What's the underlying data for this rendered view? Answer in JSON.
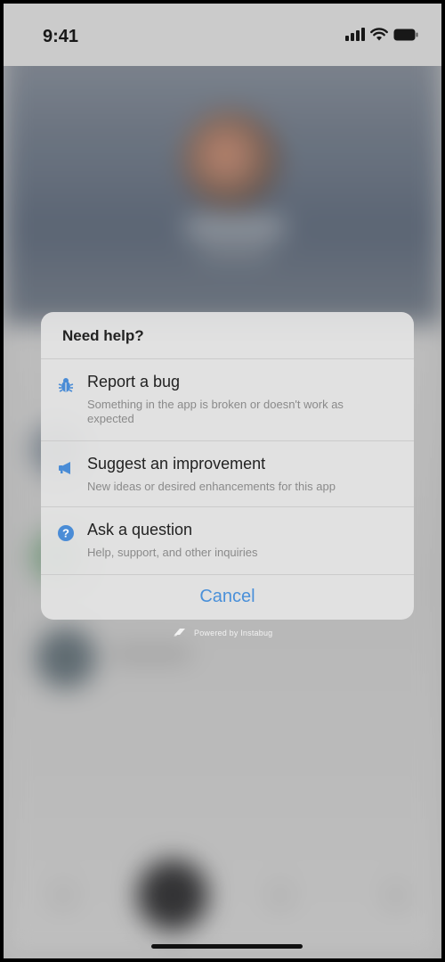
{
  "status_bar": {
    "time": "9:41"
  },
  "sheet": {
    "title": "Need help?",
    "options": [
      {
        "title": "Report a bug",
        "description": "Something in the app is broken or doesn't work as expected",
        "icon": "bug-icon"
      },
      {
        "title": "Suggest an improvement",
        "description": "New ideas or desired enhancements for this app",
        "icon": "megaphone-icon"
      },
      {
        "title": "Ask a question",
        "description": "Help, support, and other inquiries",
        "icon": "question-icon"
      }
    ],
    "cancel_label": "Cancel"
  },
  "footer": {
    "powered_by": "Powered by Instabug"
  },
  "colors": {
    "accent": "#4a90d9",
    "icon_blue": "#4a8cd6"
  }
}
